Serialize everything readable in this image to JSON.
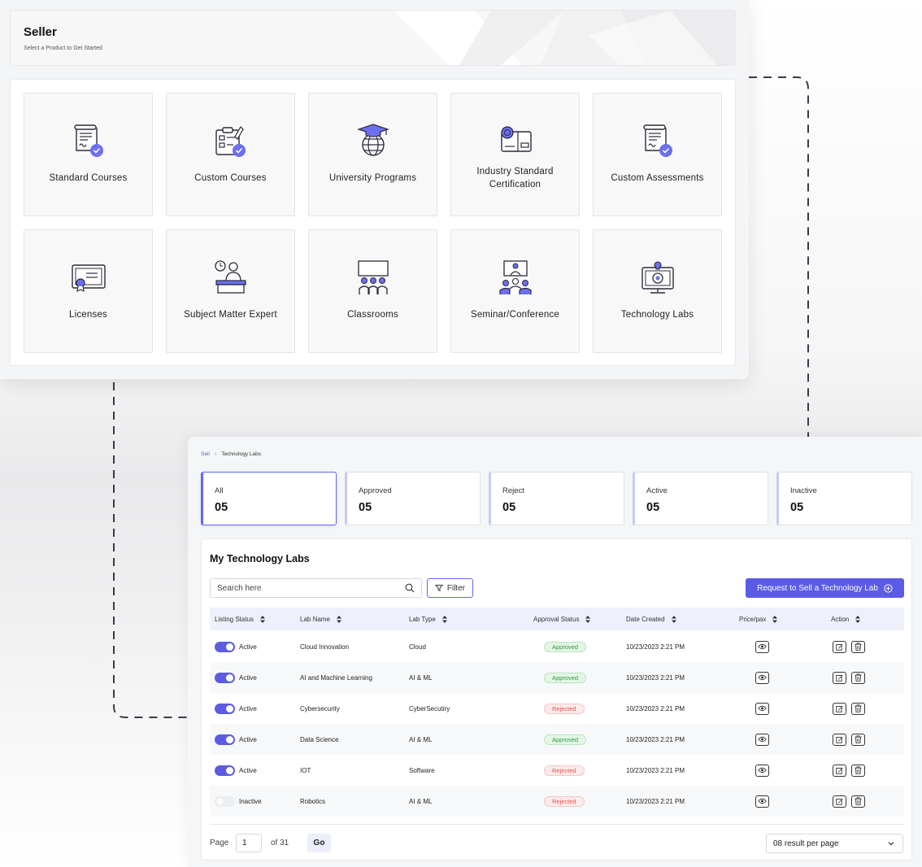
{
  "seller": {
    "title": "Seller",
    "subtitle": "Select a Product to Get Started",
    "products": [
      {
        "label": "Standard Courses",
        "icon": "certificate-check-icon"
      },
      {
        "label": "Custom Courses",
        "icon": "clipboard-check-icon"
      },
      {
        "label": "University Programs",
        "icon": "graduation-globe-icon"
      },
      {
        "label": "Industry Standard Certification",
        "icon": "certification-badge-icon"
      },
      {
        "label": "Custom Assessments",
        "icon": "certificate-check-icon"
      },
      {
        "label": "Licenses",
        "icon": "license-icon"
      },
      {
        "label": "Subject Matter Expert",
        "icon": "expert-speaker-icon"
      },
      {
        "label": "Classrooms",
        "icon": "classroom-icon"
      },
      {
        "label": "Seminar/Conference",
        "icon": "seminar-icon"
      },
      {
        "label": "Technology Labs",
        "icon": "technology-lab-icon"
      }
    ]
  },
  "labs": {
    "breadcrumb": {
      "root": "Sell",
      "current": "Technology Labs"
    },
    "stats": [
      {
        "label": "All",
        "value": "05"
      },
      {
        "label": "Approved",
        "value": "05"
      },
      {
        "label": "Reject",
        "value": "05"
      },
      {
        "label": "Active",
        "value": "05"
      },
      {
        "label": "Inactive",
        "value": "05"
      }
    ],
    "title": "My Technology Labs",
    "search_placeholder": "Search here",
    "filter_label": "Filter",
    "request_label": "Request to Sell a Technology Lab",
    "columns": [
      "Listing Status",
      "Lab Name",
      "Lab Type",
      "Approval Status",
      "Date Created",
      "Price/pax",
      "Action"
    ],
    "rows": [
      {
        "active": true,
        "status": "Active",
        "name": "Cloud Innovation",
        "type": "Cloud",
        "approval": "Approved",
        "date": "10/23/2023 2:21 PM"
      },
      {
        "active": true,
        "status": "Active",
        "name": "AI and Machine Learning",
        "type": "AI & ML",
        "approval": "Approved",
        "date": "10/23/2023 2:21 PM"
      },
      {
        "active": true,
        "status": "Active",
        "name": "Cybersecurity",
        "type": "CyberSecutiry",
        "approval": "Rejected",
        "date": "10/23/2023 2:21 PM"
      },
      {
        "active": true,
        "status": "Active",
        "name": "Data Science",
        "type": "AI & ML",
        "approval": "Approved",
        "date": "10/23/2023 2:21 PM"
      },
      {
        "active": true,
        "status": "Active",
        "name": "IOT",
        "type": "Software",
        "approval": "Rejected",
        "date": "10/23/2023 2:21 PM"
      },
      {
        "active": false,
        "status": "Inactive",
        "name": "Robotics",
        "type": "AI & ML",
        "approval": "Rejected",
        "date": "10/23/2023 2:21 PM"
      }
    ],
    "pagination": {
      "page_label": "Page",
      "page_value": "1",
      "of_label": "of 31",
      "go_label": "Go",
      "per_page": "08 result per page"
    }
  },
  "colors": {
    "accent": "#5b5ce2",
    "approved": "#2f9a43",
    "rejected": "#e05454"
  }
}
